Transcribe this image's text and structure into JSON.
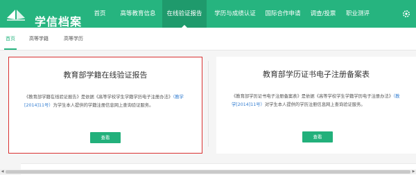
{
  "brand": {
    "name": "学信档案"
  },
  "nav": [
    {
      "label": "首页"
    },
    {
      "label": "高等教育信息"
    },
    {
      "label": "在线验证报告",
      "active": true
    },
    {
      "label": "学历与成绩认证"
    },
    {
      "label": "国际合作申请"
    },
    {
      "label": "调查/投票"
    },
    {
      "label": "职业测评"
    }
  ],
  "subnav": [
    {
      "label": "首页",
      "active": true
    },
    {
      "label": "高等学籍"
    },
    {
      "label": "高等学历"
    }
  ],
  "cards": {
    "left": {
      "title": "教育部学籍在线验证报告",
      "desc_1": "《教育部学籍在线验证报告》是依据《高等学校学生学籍学历电子注册办法》",
      "desc_link": "（教学[2014]11号）",
      "desc_2": "为学生本人提供的学籍注册信息网上查询验证服务。",
      "button": "查看"
    },
    "right": {
      "title": "教育部学历证书电子注册备案表",
      "desc_1": "《教育部学历证书电子注册备案表》是依据《高等学校学生学籍学历电子注册办法》",
      "desc_link": "（教学[2014]11号）",
      "desc_2": "对学生本人提供的学历注册信息网上查询验证服务。",
      "button": "查看"
    }
  },
  "colors": {
    "brand": "#26b47f",
    "highlight_border": "#d93030",
    "link": "#2f7bd0"
  },
  "icons": {
    "logo": "book-icon",
    "settings": "gear-icon"
  }
}
